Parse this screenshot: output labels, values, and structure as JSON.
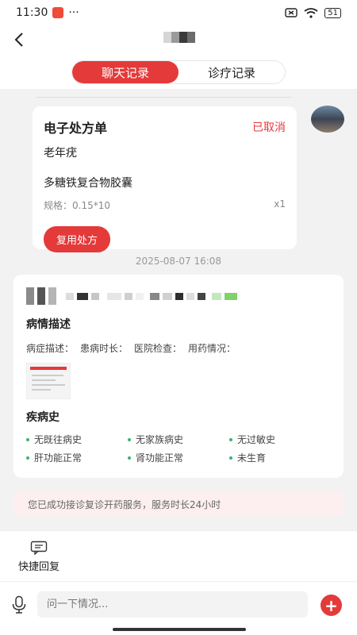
{
  "status_bar": {
    "time": "11:30",
    "dots": "···",
    "battery": "51"
  },
  "tabs": [
    {
      "label": "聊天记录",
      "active": true
    },
    {
      "label": "诊疗记录",
      "active": false
    }
  ],
  "prescription": {
    "title": "电子处方单",
    "status": "已取消",
    "diagnosis": "老年疣",
    "drug": "多糖铁复合物胶囊",
    "spec_label": "规格：0.15*10",
    "quantity": "x1",
    "reuse_button": "复用处方"
  },
  "timestamp": "2025-08-07 16:08",
  "patient_info": {
    "condition_title": "病情描述",
    "fields": [
      "病症描述：",
      "患病时长：",
      "医院检查：",
      "用药情况："
    ],
    "history_title": "疾病史",
    "history": [
      "无既往病史",
      "无家族病史",
      "无过敏史",
      "肝功能正常",
      "肾功能正常",
      "未生育"
    ]
  },
  "notice": "您已成功接诊复诊开药服务，服务时长24小时",
  "quick_reply": "快捷回复",
  "input": {
    "placeholder": "问一下情况..."
  },
  "colors": {
    "accent": "#e43a3a",
    "dot": "#3cb371"
  }
}
